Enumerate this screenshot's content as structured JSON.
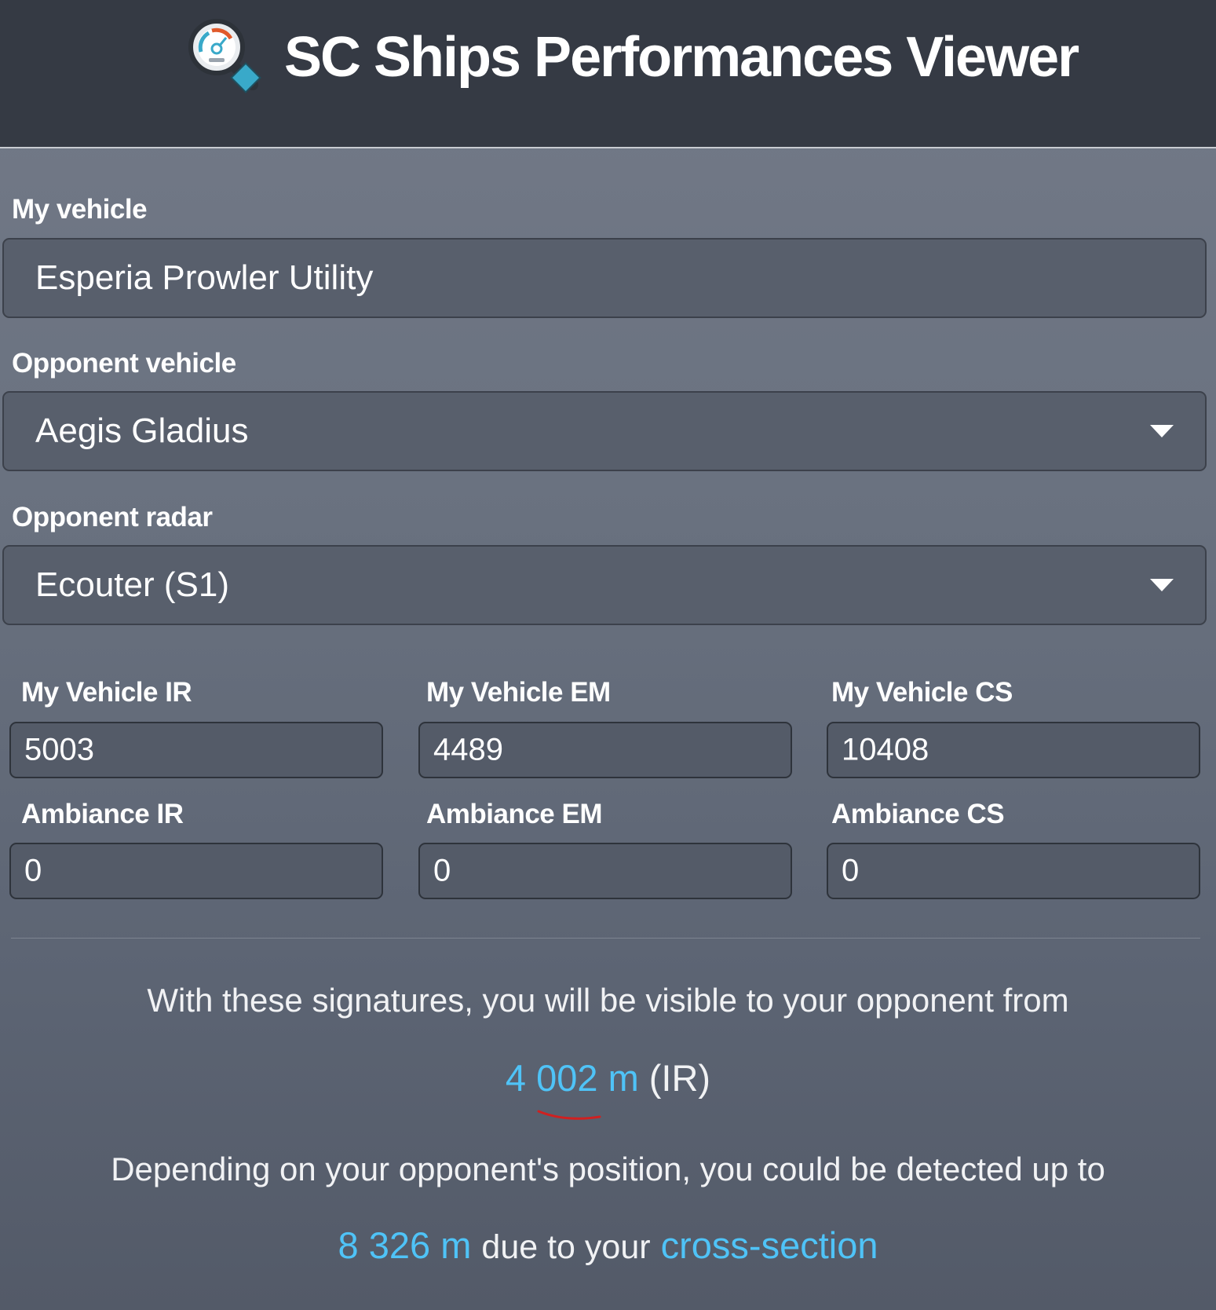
{
  "app": {
    "title": "SC Ships Performances Viewer",
    "logo_icon": "magnifier-gauge-icon"
  },
  "colors": {
    "header_bg": "#353a44",
    "accent": "#4fc3f7",
    "field_bg": "#585f6c"
  },
  "form": {
    "my_vehicle": {
      "label": "My vehicle",
      "value": "Esperia Prowler Utility"
    },
    "opponent_vehicle": {
      "label": "Opponent vehicle",
      "value": "Aegis Gladius",
      "icon": "chevron-down-icon"
    },
    "opponent_radar": {
      "label": "Opponent radar",
      "value": "Ecouter (S1)",
      "icon": "chevron-down-icon"
    }
  },
  "signatures": {
    "my_ir": {
      "label": "My Vehicle IR",
      "value": "5003"
    },
    "my_em": {
      "label": "My Vehicle EM",
      "value": "4489"
    },
    "my_cs": {
      "label": "My Vehicle CS",
      "value": "10408"
    },
    "amb_ir": {
      "label": "Ambiance IR",
      "value": "0"
    },
    "amb_em": {
      "label": "Ambiance EM",
      "value": "0"
    },
    "amb_cs": {
      "label": "Ambiance CS",
      "value": "0"
    }
  },
  "result": {
    "visible_text": "With these signatures, you will be visible to your opponent from",
    "visible_distance": "4 002 m",
    "visible_type": "(IR)",
    "detected_text": "Depending on your opponent's position, you could be detected up to",
    "detected_distance": "8 326 m",
    "detected_mid": "due to your",
    "detected_link": "cross-section"
  }
}
